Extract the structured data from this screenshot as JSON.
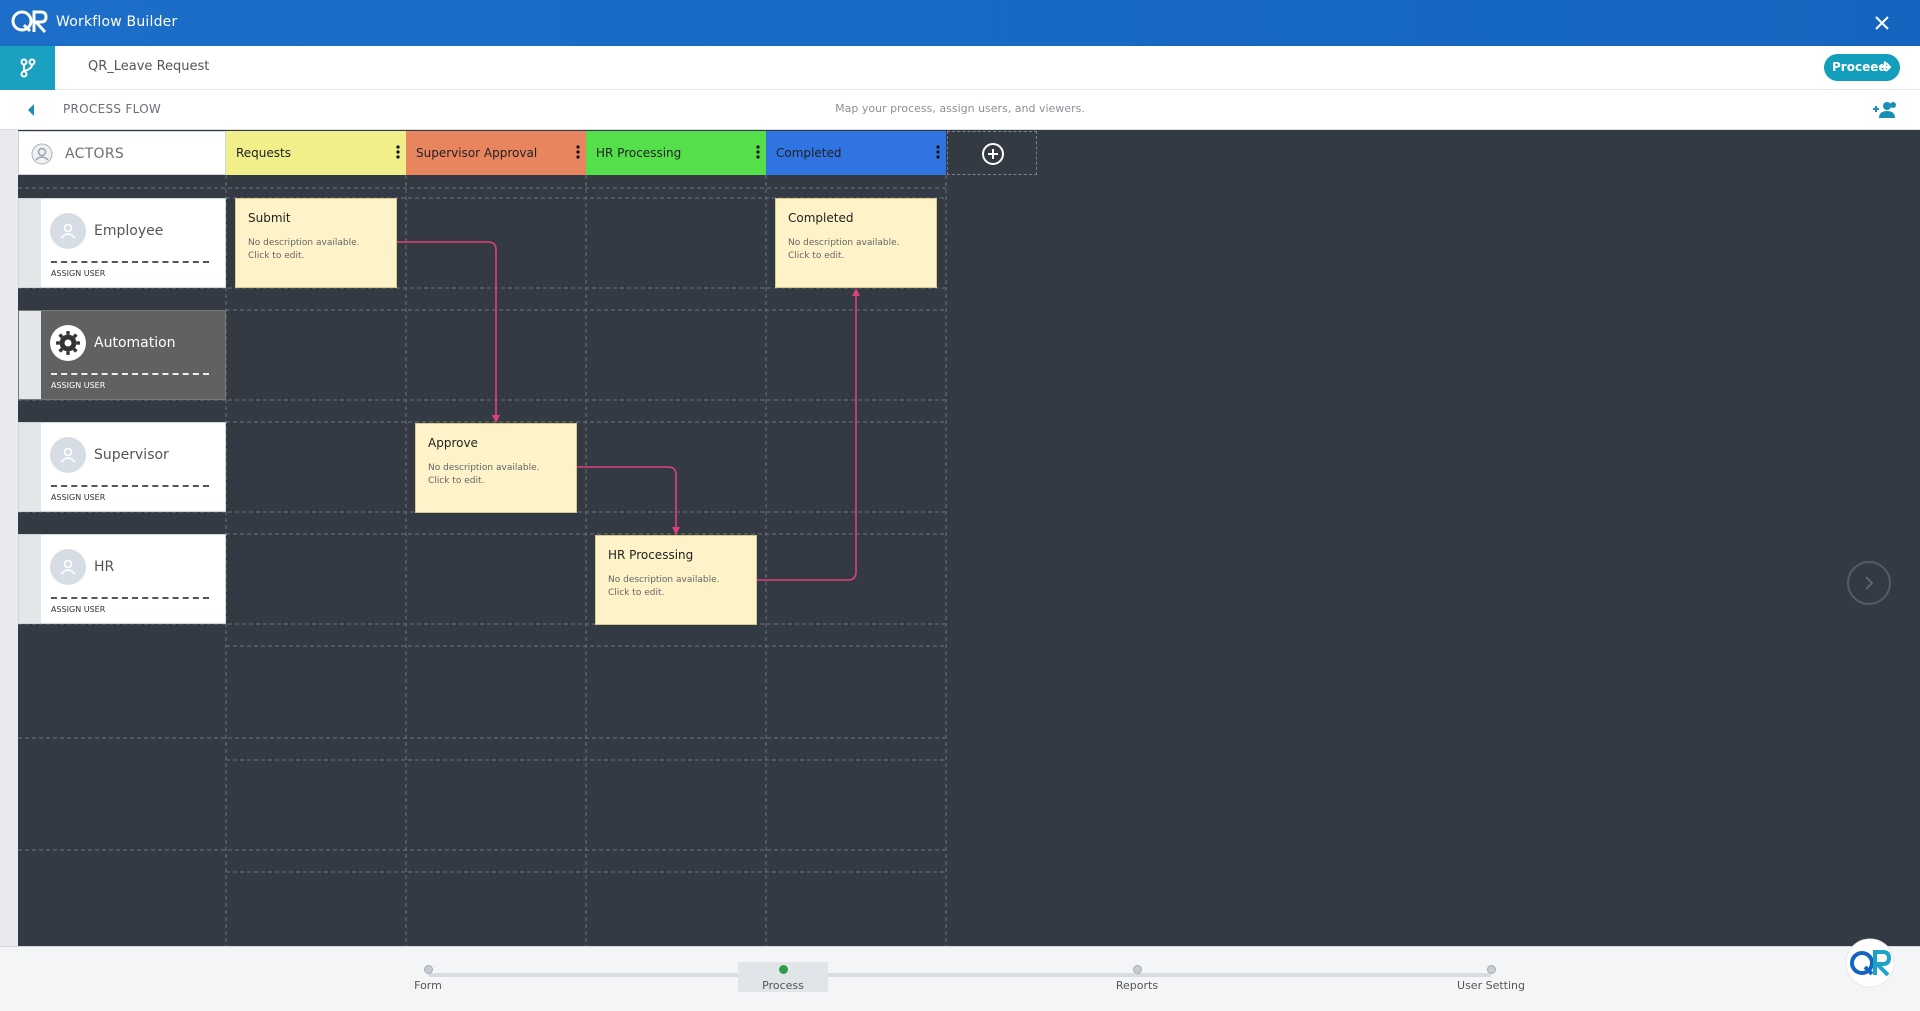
{
  "app": {
    "title": "Workflow Builder",
    "form_name": "QR_Leave Request",
    "proceed_label": "Proceed"
  },
  "process_flow": {
    "title": "PROCESS FLOW",
    "subtitle": "Map your process, assign users, and viewers."
  },
  "actors_header": "ACTORS",
  "columns": [
    {
      "label": "Requests",
      "color": "#f0ef8a"
    },
    {
      "label": "Supervisor Approval",
      "color": "#e8845e"
    },
    {
      "label": "HR Processing",
      "color": "#55e04b"
    },
    {
      "label": "Completed",
      "color": "#2f74e0"
    }
  ],
  "actors": [
    {
      "name": "Employee",
      "assign": "ASSIGN USER",
      "icon": "user-icon"
    },
    {
      "name": "Automation",
      "assign": "ASSIGN USER",
      "icon": "gear-icon"
    },
    {
      "name": "Supervisor",
      "assign": "ASSIGN USER",
      "icon": "user-icon"
    },
    {
      "name": "HR",
      "assign": "ASSIGN USER",
      "icon": "user-icon"
    }
  ],
  "tasks": [
    {
      "name": "Submit",
      "description": "No description available. Click to edit."
    },
    {
      "name": "Completed",
      "description": "No description available. Click to edit."
    },
    {
      "name": "Approve",
      "description": "No description available. Click to edit."
    },
    {
      "name": "HR Processing",
      "description": "No description available. Click to edit."
    }
  ],
  "connector_color": "#e0407a",
  "steps": [
    {
      "label": "Form"
    },
    {
      "label": "Process"
    },
    {
      "label": "Reports"
    },
    {
      "label": "User Setting"
    }
  ],
  "active_step": "Process"
}
